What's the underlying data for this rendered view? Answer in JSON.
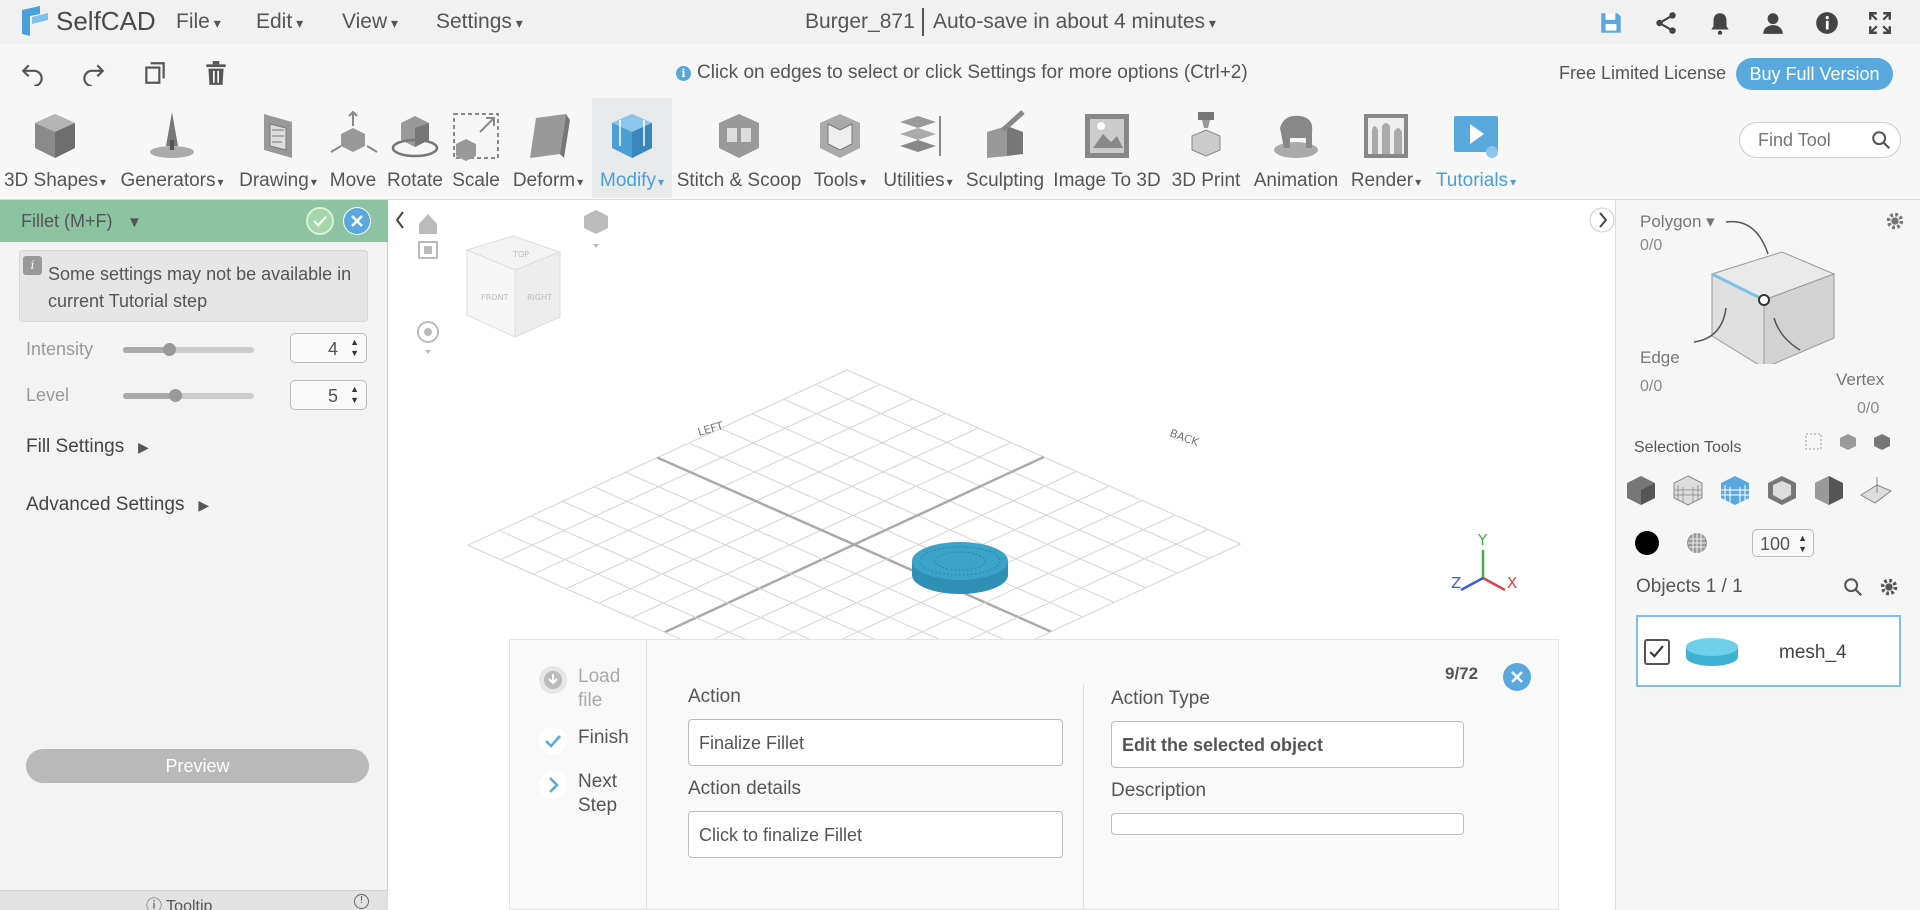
{
  "app": {
    "logo_text": "SelfCAD",
    "menus": [
      "File",
      "Edit",
      "View",
      "Settings"
    ],
    "doc_title": "Burger_871",
    "autosave": "Auto-save in about 4 minutes"
  },
  "hint_bar": {
    "hint": "Click on edges to select or click Settings for more options (Ctrl+2)",
    "license": "Free Limited License",
    "buy_label": "Buy Full Version"
  },
  "toolbar": {
    "tools": [
      {
        "label": "3D Shapes",
        "icon": "cube-icon"
      },
      {
        "label": "Generators",
        "icon": "generator-icon"
      },
      {
        "label": "Drawing",
        "icon": "drawing-icon"
      },
      {
        "label": "Move",
        "icon": "move-icon"
      },
      {
        "label": "Rotate",
        "icon": "rotate-icon"
      },
      {
        "label": "Scale",
        "icon": "scale-icon"
      },
      {
        "label": "Deform",
        "icon": "deform-icon"
      },
      {
        "label": "Modify",
        "icon": "modify-icon"
      },
      {
        "label": "Stitch & Scoop",
        "icon": "stitch-icon"
      },
      {
        "label": "Tools",
        "icon": "tools-icon"
      },
      {
        "label": "Utilities",
        "icon": "utilities-icon"
      },
      {
        "label": "Sculpting",
        "icon": "sculpting-icon"
      },
      {
        "label": "Image To 3D",
        "icon": "image-to-3d-icon"
      },
      {
        "label": "3D Print",
        "icon": "printer-icon"
      },
      {
        "label": "Animation",
        "icon": "animation-icon"
      },
      {
        "label": "Render",
        "icon": "render-icon"
      },
      {
        "label": "Tutorials",
        "icon": "tutorials-icon"
      }
    ],
    "find_placeholder": "Find Tool"
  },
  "left_panel": {
    "title": "Fillet (M+F)",
    "note": "Some settings may not be available in current Tutorial step",
    "intensity": {
      "label": "Intensity",
      "value": "4",
      "slider": 0.35
    },
    "level": {
      "label": "Level",
      "value": "5",
      "slider": 0.4
    },
    "fill_settings": "Fill Settings",
    "advanced_settings": "Advanced Settings",
    "preview": "Preview",
    "tooltip": "Tooltip"
  },
  "viewport": {
    "axis_x": "X",
    "axis_y": "Y",
    "axis_z": "Z",
    "cube_labels": {
      "top": "TOP",
      "front": "FRONT",
      "right": "RIGHT"
    },
    "grid_labels": {
      "left": "LEFT",
      "back": "BACK"
    }
  },
  "tutorial": {
    "steps": [
      "Load file",
      "Finish",
      "Next Step"
    ],
    "action_label": "Action",
    "action_value": "Finalize Fillet",
    "details_label": "Action details",
    "details_value": "Click to finalize Fillet",
    "type_label": "Action Type",
    "type_value": "Edit the selected object",
    "desc_label": "Description",
    "desc_value": "",
    "counter": "9/72"
  },
  "right_panel": {
    "polygon_label": "Polygon",
    "polygon_count": "0/0",
    "edge_label": "Edge",
    "edge_count": "0/0",
    "vertex_label": "Vertex",
    "vertex_count": "0/0",
    "selection_tools": "Selection Tools",
    "opacity": "100",
    "objects_label": "Objects 1 / 1",
    "object_name": "mesh_4"
  },
  "colors": {
    "accent": "#5aa9de",
    "panel_header": "#8cc3a0",
    "mesh": "#3aa3c7"
  }
}
